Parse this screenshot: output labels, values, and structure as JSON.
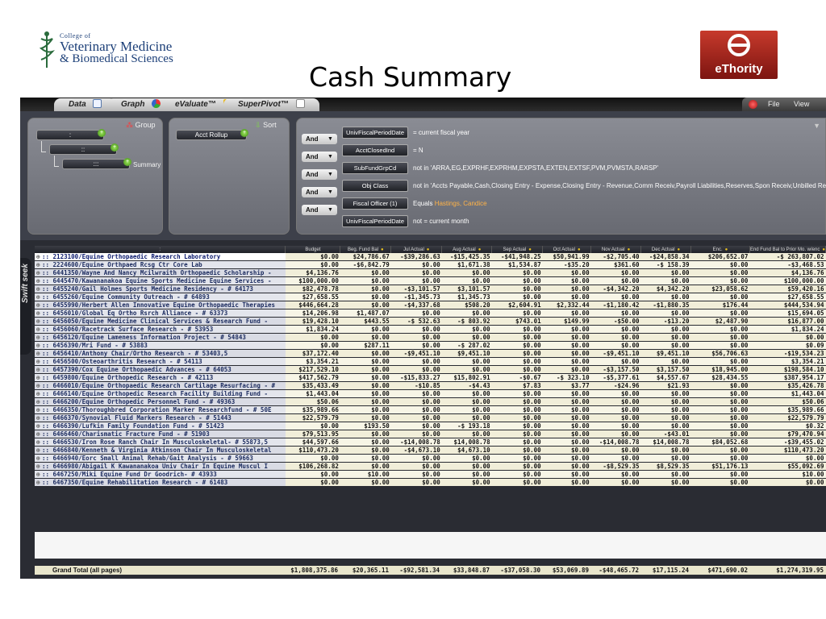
{
  "slide": {
    "title": "Cash Summary",
    "college_logo": {
      "line1": "College of",
      "line2": "Veterinary Medicine",
      "line3": "& Biomedical Sciences"
    },
    "vendor_logo": "eThority"
  },
  "tabs": [
    {
      "label": "Data",
      "icon": "table-icon"
    },
    {
      "label": "Graph",
      "icon": "pie-chart-icon"
    },
    {
      "label": "eValuate™",
      "icon": "bar-chart-icon"
    },
    {
      "label": "SuperPivot™",
      "icon": "pivot-icon"
    }
  ],
  "window_controls": {
    "file": "File",
    "view": "View"
  },
  "group_panel": {
    "title": "Group",
    "levels": [
      ":",
      "::",
      ":::"
    ],
    "summary_label": "Summary"
  },
  "sort_panel": {
    "title": "Sort",
    "item": "Acct Rollup"
  },
  "filters": [
    {
      "join": "",
      "field": "UnivFiscalPeriodDate",
      "condition": "= current fiscal year",
      "highlight": ""
    },
    {
      "join": "And",
      "field": "AcctClosedInd",
      "condition": "= N",
      "highlight": ""
    },
    {
      "join": "And",
      "field": "SubFundGrpCd",
      "condition": "not in 'ARRA,EG,EXPRHF,EXPRHM,EXPSTA,EXTEN,EXTSF,PVM,PVMSTA,RARSP'",
      "highlight": ""
    },
    {
      "join": "And",
      "field": "Obj Class",
      "condition": "not in 'Accts Payable,Cash,Closing Entry - Expense,Closing Entry - Revenue,Comm Receiv,Payroll Liabilities,Reserves,Spon Receiv,Unbilled Re",
      "highlight": ""
    },
    {
      "join": "And",
      "field": "Fiscal Officer (1)",
      "condition": "Equals ",
      "highlight": "Hastings, Candice"
    },
    {
      "join": "And",
      "field": "UnivFiscalPeriodDate",
      "condition": "not = current month",
      "highlight": ""
    }
  ],
  "swift_seek": "Swift seek",
  "columns": [
    ":",
    "Budget",
    "Beg. Fund Bal",
    "Jul Actual",
    "Aug Actual",
    "Sep Actual",
    "Oct Actual",
    "Nov Actual",
    "Dec Actual",
    "Enc.",
    "End Fund Bal to Prior Mo. w/enc"
  ],
  "rows": [
    [
      ":: 2123100/Equine Orthopaedic Research Laboratory",
      "$0.00",
      "$24,786.67",
      "-$39,286.63",
      "-$15,425.35",
      "-$41,948.25",
      "$50,941.99",
      "-$2,705.40",
      "-$24,858.34",
      "$206,652.07",
      "-$ 263,807.02"
    ],
    [
      ":: 2224600/Equine Orthpaed Rcsg Ctr Core Lab",
      "$0.00",
      "-$6,842.79",
      "$0.00",
      "$1,671.38",
      "$1,534.87",
      "-$35.20",
      "$361.60",
      "-$ 158.39",
      "$0.00",
      "-$3,468.53"
    ],
    [
      ":: 6441350/Wayne And Nancy Mcilwraith Orthopaedic Scholarship -",
      "$4,136.76",
      "$0.00",
      "$0.00",
      "$0.00",
      "$0.00",
      "$0.00",
      "$0.00",
      "$0.00",
      "$0.00",
      "$4,136.76"
    ],
    [
      ":: 6445470/Kawananakoa Equine Sports Medicine Equine Services -",
      "$100,000.00",
      "$0.00",
      "$0.00",
      "$0.00",
      "$0.00",
      "$0.00",
      "$0.00",
      "$0.00",
      "$0.00",
      "$100,000.00"
    ],
    [
      ":: 6455240/Gail Holmes Sports Medicine Residency - # 64173",
      "$82,478.78",
      "$0.00",
      "-$3,101.57",
      "$3,101.57",
      "$0.00",
      "$0.00",
      "-$4,342.20",
      "$4,342.20",
      "$23,058.62",
      "$59,420.16"
    ],
    [
      ":: 6455260/Equine Community Outreach - # 64893",
      "$27,658.55",
      "$0.00",
      "-$1,345.73",
      "$1,345.73",
      "$0.00",
      "$0.00",
      "$0.00",
      "$0.00",
      "$0.00",
      "$27,658.55"
    ],
    [
      ":: 6455990/Herbert Allen Innovative Equine Orthopaedic Therapies",
      "$446,664.28",
      "$0.00",
      "-$4,337.68",
      "$508.20",
      "$2,604.91",
      "$2,332.44",
      "-$1,180.42",
      "-$1,880.35",
      "$176.44",
      "$444,534.94"
    ],
    [
      ":: 6456010/Global Eq Ortho Rsrch Alliance       - # 63373",
      "$14,206.98",
      "$1,487.07",
      "$0.00",
      "$0.00",
      "$0.00",
      "$0.00",
      "$0.00",
      "$0.00",
      "$0.00",
      "$15,694.05"
    ],
    [
      ":: 6456050/Equine Medicine Clinical Services &    Research Fund -",
      "$19,428.10",
      "$443.55",
      "-$ 532.63",
      "-$ 803.92",
      "$743.01",
      "$149.99",
      "-$50.00",
      "-$13.20",
      "$2,487.90",
      "$16,877.00"
    ],
    [
      ":: 6456060/Racetrack Surface Research          - # 53953",
      "$1,834.24",
      "$0.00",
      "$0.00",
      "$0.00",
      "$0.00",
      "$0.00",
      "$0.00",
      "$0.00",
      "$0.00",
      "$1,834.24"
    ],
    [
      ":: 6456120/Equine Lameness Information Project    - # 54843",
      "$0.00",
      "$0.00",
      "$0.00",
      "$0.00",
      "$0.00",
      "$0.00",
      "$0.00",
      "$0.00",
      "$0.00",
      "$0.00"
    ],
    [
      ":: 6456390/Mri Fund                  - # 53883",
      "$0.00",
      "$287.11",
      "$0.00",
      "-$ 287.02",
      "$0.00",
      "$0.00",
      "$0.00",
      "$0.00",
      "$0.00",
      "$0.09"
    ],
    [
      ":: 6456410/Anthony Chair/Ortho Research       - # 53403,5",
      "$37,172.40",
      "$0.00",
      "-$9,451.10",
      "$9,451.10",
      "$0.00",
      "$0.00",
      "-$9,451.10",
      "$9,451.10",
      "$56,706.63",
      "-$19,534.23"
    ],
    [
      ":: 6456500/Osteoarthritis Research           - # 54113",
      "$3,354.21",
      "$0.00",
      "$0.00",
      "$0.00",
      "$0.00",
      "$0.00",
      "$0.00",
      "$0.00",
      "$0.00",
      "$3,354.21"
    ],
    [
      ":: 6457390/Cox Equine Orthopaedic Advances - # 64053",
      "$217,529.10",
      "$0.00",
      "$0.00",
      "$0.00",
      "$0.00",
      "$0.00",
      "-$3,157.50",
      "$3,157.50",
      "$18,945.00",
      "$198,584.10"
    ],
    [
      ":: 6459800/Equine Orthopedic Research         - # 42113",
      "$417,562.79",
      "$0.00",
      "-$15,833.27",
      "$15,802.91",
      "-$0.67",
      "-$ 323.10",
      "-$5,377.61",
      "$4,557.67",
      "$28,434.55",
      "$387,954.17"
    ],
    [
      ":: 6466010/Equine Orthopaedic Research Cartilage  Resurfacing - #",
      "$35,433.49",
      "$0.00",
      "-$10.85",
      "-$4.43",
      "$7.83",
      "$3.77",
      "-$24.96",
      "$21.93",
      "$0.00",
      "$35,426.78"
    ],
    [
      ":: 6466140/Equine Orthopedic Research Facility    Building Fund -",
      "$1,443.04",
      "$0.00",
      "$0.00",
      "$0.00",
      "$0.00",
      "$0.00",
      "$0.00",
      "$0.00",
      "$0.00",
      "$1,443.04"
    ],
    [
      ":: 6466200/Equine Orthopedic Personnel Fund      - # 49363",
      "$50.06",
      "$0.00",
      "$0.00",
      "$0.00",
      "$0.00",
      "$0.00",
      "$0.00",
      "$0.00",
      "$0.00",
      "$50.06"
    ],
    [
      ":: 6466350/Thoroughbred Corporation Marker Researchfund - # 50E",
      "$35,989.66",
      "$0.00",
      "$0.00",
      "$0.00",
      "$0.00",
      "$0.00",
      "$0.00",
      "$0.00",
      "$0.00",
      "$35,989.66"
    ],
    [
      ":: 6466370/Synovial Fluid Markers Research       - # 51443",
      "$22,579.79",
      "$0.00",
      "$0.00",
      "$0.00",
      "$0.00",
      "$0.00",
      "$0.00",
      "$0.00",
      "$0.00",
      "$22,579.79"
    ],
    [
      ":: 6466390/Lufkin Family Foundation Fund       - # 51423",
      "$0.00",
      "$193.50",
      "$0.00",
      "-$ 193.18",
      "$0.00",
      "$0.00",
      "$0.00",
      "$0.00",
      "$0.00",
      "$0.32"
    ],
    [
      ":: 6466460/Charismatic Fracture Fund          - # 51903",
      "$79,513.95",
      "$0.00",
      "$0.00",
      "$0.00",
      "$0.00",
      "$0.00",
      "$0.00",
      "-$43.01",
      "$0.00",
      "$79,470.94"
    ],
    [
      ":: 6466530/Iron Rose Ranch Chair In Musculoskeletal- # 55873,5",
      "$44,597.66",
      "$0.00",
      "-$14,008.78",
      "$14,008.78",
      "$0.00",
      "$0.00",
      "-$14,008.78",
      "$14,008.78",
      "$84,052.68",
      "-$39,455.02"
    ],
    [
      ":: 6466840/Kenneth & Virginia Atkinson Chair In   Musculoskeletal",
      "$110,473.20",
      "$0.00",
      "-$4,673.10",
      "$4,673.10",
      "$0.00",
      "$0.00",
      "$0.00",
      "$0.00",
      "$0.00",
      "$110,473.20"
    ],
    [
      ":: 6466940/Eorc Small Animal Rehab/Gait Analysis  - # 59663",
      "$0.00",
      "$0.00",
      "$0.00",
      "$0.00",
      "$0.00",
      "$0.00",
      "$0.00",
      "$0.00",
      "$0.00",
      "$0.00"
    ],
    [
      ":: 6466980/Abigail K Kawananakoa Univ Chair In   Equine Muscul I",
      "$106,268.82",
      "$0.00",
      "$0.00",
      "$0.00",
      "$0.00",
      "$0.00",
      "-$8,529.35",
      "$8,529.35",
      "$51,176.13",
      "$55,092.69"
    ],
    [
      ":: 6467250/Miki Equine Fund Dr Goodrich- # 43933",
      "$0.00",
      "$10.00",
      "$0.00",
      "$0.00",
      "$0.00",
      "$0.00",
      "$0.00",
      "$0.00",
      "$0.00",
      "$10.00"
    ],
    [
      ":: 6467350/Equine Rehabilitation Research - # 61483",
      "$0.00",
      "$0.00",
      "$0.00",
      "$0.00",
      "$0.00",
      "$0.00",
      "$0.00",
      "$0.00",
      "$0.00",
      "$0.00"
    ]
  ],
  "totals": {
    "label": "Grand Total (all pages)",
    "values": [
      "$1,808,375.86",
      "$20,365.11",
      "-$92,581.34",
      "$33,848.87",
      "-$37,058.30",
      "$53,069.89",
      "-$48,465.72",
      "$17,115.24",
      "$471,690.02",
      "$1,274,319.95"
    ]
  }
}
